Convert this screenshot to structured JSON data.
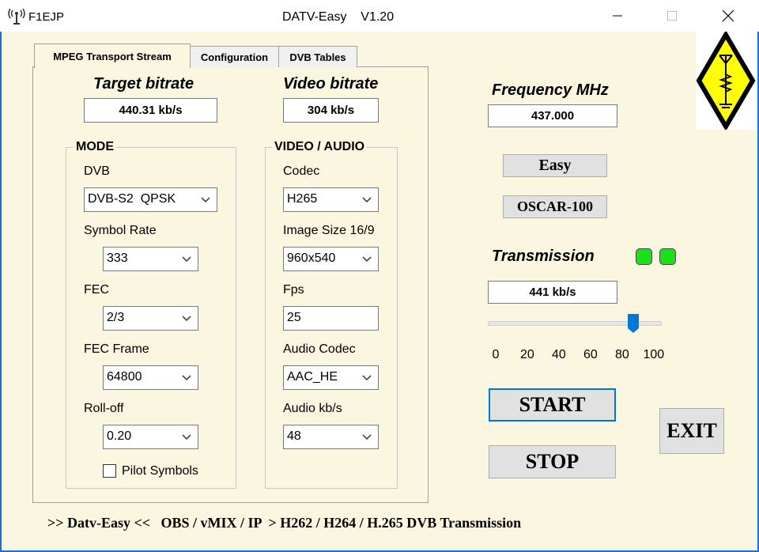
{
  "window": {
    "app_name": "F1EJP",
    "title": "DATV-Easy    V1.20",
    "icons": [
      "antenna-icon",
      "minimize-icon",
      "maximize-icon",
      "close-icon"
    ]
  },
  "tabs": [
    {
      "label": "MPEG Transport Stream",
      "active": true
    },
    {
      "label": "Configuration",
      "active": false
    },
    {
      "label": "DVB Tables",
      "active": false
    }
  ],
  "bitrates": {
    "target_label": "Target bitrate",
    "target_value": "440.31 kb/s",
    "video_label": "Video bitrate",
    "video_value": "304 kb/s"
  },
  "mode": {
    "title": "MODE",
    "dvb_label": "DVB",
    "dvb_value": "DVB-S2  QPSK",
    "symbol_rate_label": "Symbol Rate",
    "symbol_rate_value": "333",
    "fec_label": "FEC",
    "fec_value": "2/3",
    "fec_frame_label": "FEC Frame",
    "fec_frame_value": "64800",
    "rolloff_label": "Roll-off",
    "rolloff_value": "0.20",
    "pilot_label": "Pilot Symbols",
    "pilot_checked": false
  },
  "video_audio": {
    "title": "VIDEO / AUDIO",
    "codec_label": "Codec",
    "codec_value": "H265",
    "image_size_label": "Image Size 16/9",
    "image_size_value": "960x540",
    "fps_label": "Fps",
    "fps_value": "25",
    "audio_codec_label": "Audio Codec",
    "audio_codec_value": "AAC_HE",
    "audio_kbs_label": "Audio kb/s",
    "audio_kbs_value": "48"
  },
  "frequency": {
    "label": "Frequency MHz",
    "value": "437.000"
  },
  "buttons": {
    "easy": "Easy",
    "oscar": "OSCAR-100",
    "start": "START",
    "stop": "STOP",
    "exit": "EXIT"
  },
  "transmission": {
    "label": "Transmission",
    "value": "441 kb/s",
    "led_color": "#19e019",
    "slider_value": 87,
    "slider_min": 0,
    "slider_max": 100,
    "ticks": [
      "0",
      "20",
      "40",
      "60",
      "80",
      "100"
    ]
  },
  "colors": {
    "background": "#fbf6e0",
    "accent_blue": "#0078d7",
    "logo_yellow": "#ffff00"
  },
  "footer": ">> Datv-Easy <<   OBS / vMIX / IP  > H262 / H264 / H.265 DVB Transmission"
}
